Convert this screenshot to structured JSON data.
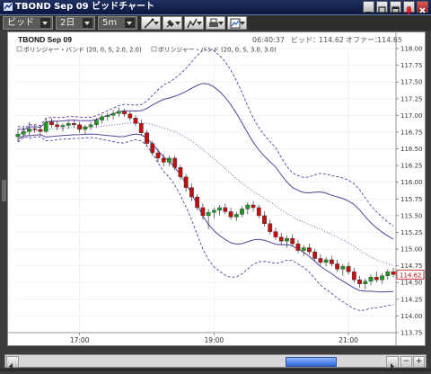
{
  "window": {
    "title": "TBOND Sep 09 ビッドチャート"
  },
  "toolbar": {
    "price_type": "ビッド",
    "period": "2日",
    "interval": "5m",
    "tools": [
      "trendline-tool-icon",
      "marker-tool-icon",
      "draw-tool-icon",
      "print-icon",
      "chart-settings-icon"
    ]
  },
  "chart": {
    "symbol": "TBOND Sep 09",
    "time": "06:40:37",
    "bid_label": "ビッド：",
    "bid": "114.62",
    "offer_label": "オファー：",
    "offer": "114.65",
    "legend": [
      "ボリンジャー・バンド (20, 0, S, 2.0, 2.0)",
      "ボリンジャー・バンド (20, 0, S, 3.0, 3.0)"
    ],
    "current_price_tag": "114.62",
    "colors": {
      "up": "#1f9a1f",
      "down": "#c01010",
      "band": "#5a3e9e",
      "tag": "#c01010"
    }
  },
  "chart_data": {
    "type": "candlestick",
    "ylim": [
      113.75,
      118.0
    ],
    "y_ticks": [
      "118.00",
      "117.75",
      "117.50",
      "117.25",
      "117.00",
      "116.75",
      "116.50",
      "116.25",
      "116.00",
      "115.75",
      "115.50",
      "115.25",
      "115.00",
      "114.75",
      "114.50",
      "114.25",
      "114.00",
      "113.75"
    ],
    "x_ticks": [
      {
        "label": "17:00",
        "index": 11
      },
      {
        "label": "19:00",
        "index": 35
      },
      {
        "label": "21:00",
        "index": 59
      }
    ],
    "candles": [
      [
        116.68,
        116.8,
        116.6,
        116.72
      ],
      [
        116.72,
        116.85,
        116.66,
        116.76
      ],
      [
        116.76,
        116.9,
        116.7,
        116.8
      ],
      [
        116.8,
        116.86,
        116.74,
        116.79
      ],
      [
        116.79,
        116.85,
        116.7,
        116.76
      ],
      [
        116.76,
        116.96,
        116.74,
        116.9
      ],
      [
        116.9,
        116.96,
        116.82,
        116.86
      ],
      [
        116.86,
        116.92,
        116.78,
        116.83
      ],
      [
        116.83,
        116.88,
        116.76,
        116.85
      ],
      [
        116.85,
        116.92,
        116.8,
        116.88
      ],
      [
        116.88,
        116.94,
        116.82,
        116.86
      ],
      [
        116.86,
        116.9,
        116.74,
        116.79
      ],
      [
        116.79,
        116.86,
        116.72,
        116.83
      ],
      [
        116.83,
        116.9,
        116.78,
        116.86
      ],
      [
        116.86,
        116.96,
        116.82,
        116.93
      ],
      [
        116.93,
        117.02,
        116.88,
        116.98
      ],
      [
        116.98,
        117.04,
        116.92,
        117.0
      ],
      [
        117.0,
        117.08,
        116.94,
        117.03
      ],
      [
        117.03,
        117.12,
        116.98,
        117.06
      ],
      [
        117.06,
        117.1,
        116.98,
        117.02
      ],
      [
        117.02,
        117.06,
        116.92,
        116.96
      ],
      [
        116.96,
        117.0,
        116.84,
        116.88
      ],
      [
        116.88,
        116.94,
        116.7,
        116.74
      ],
      [
        116.74,
        116.78,
        116.54,
        116.58
      ],
      [
        116.58,
        116.62,
        116.4,
        116.44
      ],
      [
        116.44,
        116.5,
        116.3,
        116.36
      ],
      [
        116.36,
        116.42,
        116.24,
        116.3
      ],
      [
        116.3,
        116.4,
        116.24,
        116.36
      ],
      [
        116.36,
        116.4,
        116.18,
        116.22
      ],
      [
        116.22,
        116.26,
        116.04,
        116.08
      ],
      [
        116.08,
        116.12,
        115.86,
        115.92
      ],
      [
        115.92,
        115.98,
        115.72,
        115.78
      ],
      [
        115.78,
        115.82,
        115.58,
        115.62
      ],
      [
        115.62,
        115.68,
        115.44,
        115.5
      ],
      [
        115.5,
        115.6,
        115.3,
        115.55
      ],
      [
        115.55,
        115.62,
        115.46,
        115.58
      ],
      [
        115.58,
        115.66,
        115.5,
        115.62
      ],
      [
        115.62,
        115.68,
        115.52,
        115.56
      ],
      [
        115.56,
        115.62,
        115.44,
        115.48
      ],
      [
        115.48,
        115.56,
        115.42,
        115.52
      ],
      [
        115.52,
        115.64,
        115.48,
        115.6
      ],
      [
        115.6,
        115.7,
        115.52,
        115.66
      ],
      [
        115.66,
        115.72,
        115.56,
        115.62
      ],
      [
        115.62,
        115.66,
        115.46,
        115.5
      ],
      [
        115.5,
        115.56,
        115.34,
        115.38
      ],
      [
        115.38,
        115.44,
        115.22,
        115.26
      ],
      [
        115.26,
        115.32,
        115.14,
        115.18
      ],
      [
        115.18,
        115.24,
        115.06,
        115.12
      ],
      [
        115.12,
        115.2,
        115.02,
        115.16
      ],
      [
        115.16,
        115.22,
        115.04,
        115.08
      ],
      [
        115.08,
        115.14,
        114.94,
        114.98
      ],
      [
        114.98,
        115.06,
        114.9,
        115.02
      ],
      [
        115.02,
        115.08,
        114.92,
        114.96
      ],
      [
        114.96,
        115.0,
        114.82,
        114.86
      ],
      [
        114.86,
        114.92,
        114.76,
        114.8
      ],
      [
        114.8,
        114.88,
        114.74,
        114.84
      ],
      [
        114.84,
        114.9,
        114.74,
        114.78
      ],
      [
        114.78,
        114.84,
        114.66,
        114.7
      ],
      [
        114.7,
        114.78,
        114.6,
        114.74
      ],
      [
        114.74,
        114.8,
        114.62,
        114.66
      ],
      [
        114.66,
        114.72,
        114.5,
        114.54
      ],
      [
        114.54,
        114.6,
        114.42,
        114.48
      ],
      [
        114.48,
        114.56,
        114.4,
        114.52
      ],
      [
        114.52,
        114.62,
        114.46,
        114.58
      ],
      [
        114.58,
        114.66,
        114.5,
        114.54
      ],
      [
        114.54,
        114.64,
        114.48,
        114.6
      ],
      [
        114.6,
        114.7,
        114.54,
        114.66
      ],
      [
        114.66,
        114.72,
        114.58,
        114.62
      ]
    ]
  },
  "scrollbar": {
    "zoom_minus": "−",
    "zoom_plus": "+"
  }
}
